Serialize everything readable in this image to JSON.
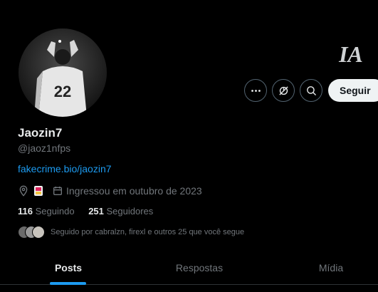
{
  "profile": {
    "name": "Jaozin7",
    "handle": "@jaoz1nfps",
    "link": "fakecrime.bio/jaozin7",
    "joined": "Ingressou em outubro de 2023",
    "avatar_jersey_number": "22",
    "banner_logo_text": "IA"
  },
  "buttons": {
    "more_icon": "more-horizontal-icon",
    "notify_icon": "notifications-off-icon",
    "search_icon": "search-icon",
    "follow_label": "Seguir"
  },
  "stats": {
    "following_count": "116",
    "following_label": "Seguindo",
    "followers_count": "251",
    "followers_label": "Seguidores"
  },
  "followed_by": {
    "text": "Seguido por cabralzn, firexl e outros 25 que você segue"
  },
  "tabs": [
    {
      "label": "Posts",
      "active": true
    },
    {
      "label": "Respostas",
      "active": false
    },
    {
      "label": "Mídia",
      "active": false
    }
  ],
  "colors": {
    "background": "#000000",
    "text_primary": "#e7e9ea",
    "text_secondary": "#71767b",
    "accent": "#1d9bf0",
    "border": "#536471"
  }
}
